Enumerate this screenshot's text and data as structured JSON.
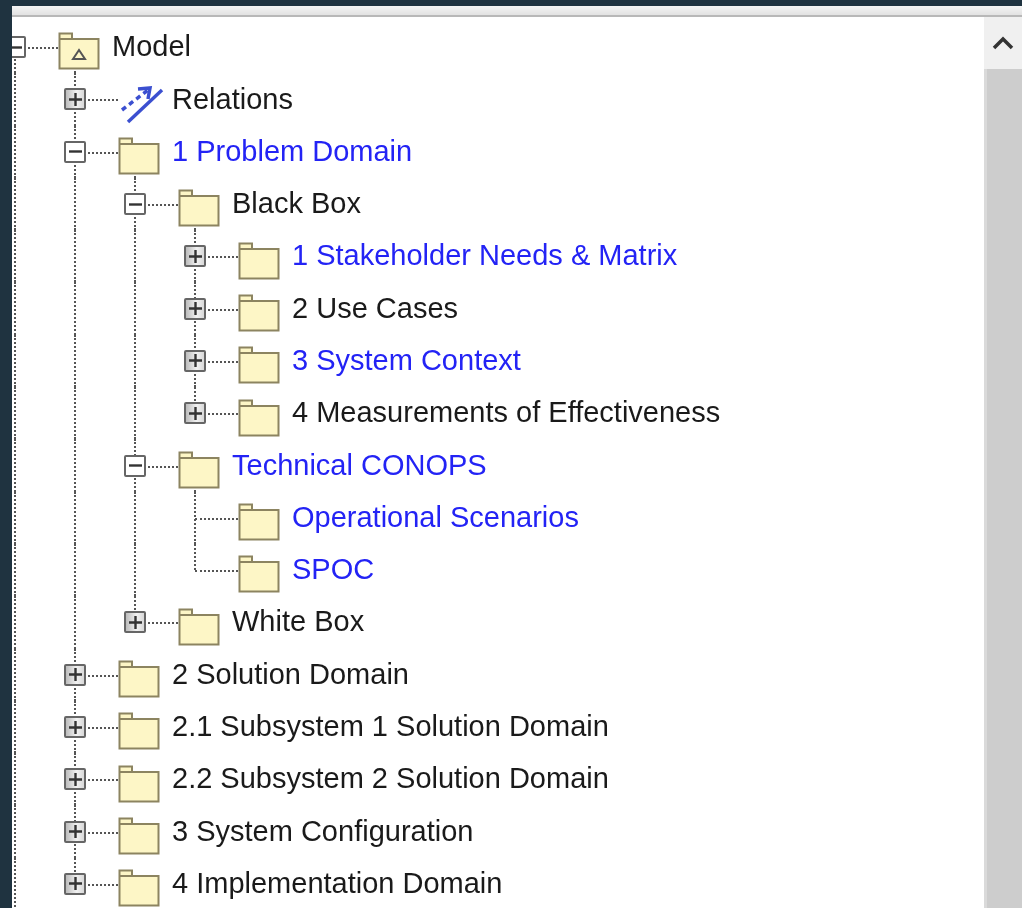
{
  "tree": [
    {
      "label": "Model",
      "kind": "model",
      "expanded": true,
      "color": "#1a1a1a",
      "children": [
        {
          "label": "Relations",
          "kind": "relations",
          "expanded": false,
          "color": "#1a1a1a"
        },
        {
          "label": "1 Problem Domain",
          "kind": "package",
          "expanded": true,
          "color": "#2323f5",
          "children": [
            {
              "label": "Black Box",
              "kind": "package",
              "expanded": true,
              "color": "#1a1a1a",
              "children": [
                {
                  "label": "1 Stakeholder Needs & Matrix",
                  "kind": "package",
                  "expanded": false,
                  "color": "#2323f5"
                },
                {
                  "label": "2 Use Cases",
                  "kind": "package",
                  "expanded": false,
                  "color": "#1a1a1a"
                },
                {
                  "label": "3 System Context",
                  "kind": "package",
                  "expanded": false,
                  "color": "#2323f5"
                },
                {
                  "label": "4 Measurements of Effectiveness",
                  "kind": "package",
                  "expanded": false,
                  "color": "#1a1a1a"
                }
              ]
            },
            {
              "label": "Technical CONOPS",
              "kind": "package",
              "expanded": true,
              "color": "#2323f5",
              "children": [
                {
                  "label": "Operational Scenarios",
                  "kind": "package",
                  "color": "#2323f5"
                },
                {
                  "label": "SPOC",
                  "kind": "package",
                  "color": "#2323f5"
                }
              ]
            },
            {
              "label": "White Box",
              "kind": "package",
              "expanded": false,
              "color": "#1a1a1a"
            }
          ]
        },
        {
          "label": "2 Solution Domain",
          "kind": "package",
          "expanded": false,
          "color": "#1a1a1a"
        },
        {
          "label": "2.1 Subsystem 1 Solution Domain",
          "kind": "package",
          "expanded": false,
          "color": "#1a1a1a"
        },
        {
          "label": "2.2 Subsystem 2 Solution Domain",
          "kind": "package",
          "expanded": false,
          "color": "#1a1a1a"
        },
        {
          "label": "3 System Configuration",
          "kind": "package",
          "expanded": false,
          "color": "#1a1a1a"
        },
        {
          "label": "4 Implementation Domain",
          "kind": "package",
          "expanded": false,
          "color": "#1a1a1a"
        }
      ]
    }
  ]
}
